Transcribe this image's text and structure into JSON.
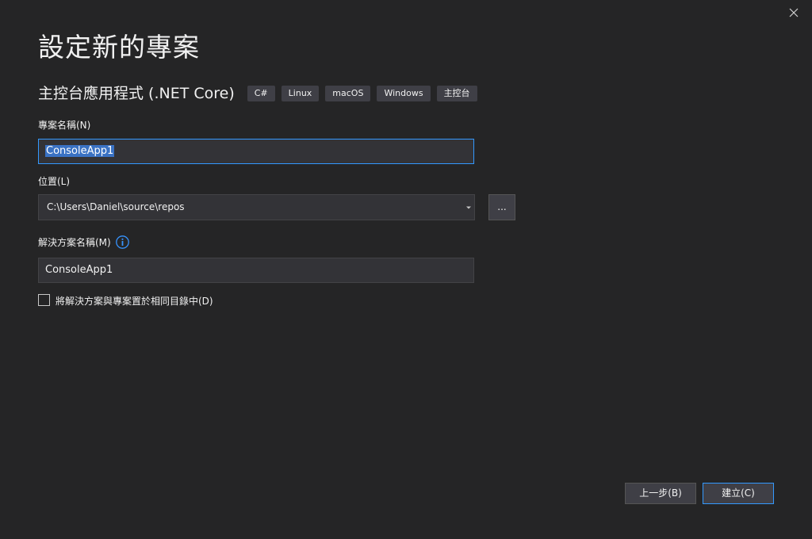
{
  "dialog": {
    "title": "設定新的專案",
    "close_icon": "close-icon"
  },
  "template": {
    "name": "主控台應用程式 (.NET Core)",
    "tags": [
      "C#",
      "Linux",
      "macOS",
      "Windows",
      "主控台"
    ]
  },
  "project_name": {
    "label": "專案名稱(N)",
    "value": "ConsoleApp1"
  },
  "location": {
    "label": "位置(L)",
    "value": "C:\\Users\\Daniel\\source\\repos",
    "browse_label": "..."
  },
  "solution_name": {
    "label": "解決方案名稱(M)",
    "value": "ConsoleApp1",
    "info_icon": "info-icon"
  },
  "same_directory": {
    "label": "將解決方案與專案置於相同目錄中(D)",
    "checked": false
  },
  "buttons": {
    "back_label": "上一步(B)",
    "create_label": "建立(C)"
  },
  "colors": {
    "background": "#252526",
    "input_background": "#333337",
    "focus_border": "#3399ff",
    "selection": "#3a72c4",
    "info_blue": "#3794ff"
  }
}
